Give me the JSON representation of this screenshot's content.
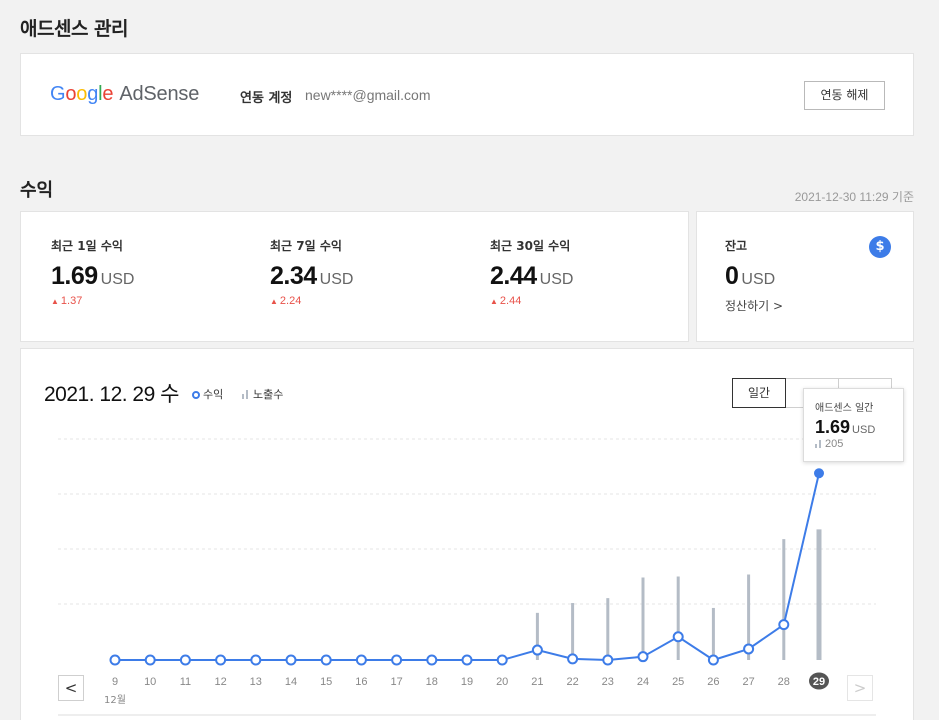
{
  "page": {
    "title": "애드센스 관리"
  },
  "adsense": {
    "logo_google": [
      "G",
      "o",
      "o",
      "g",
      "l",
      "e"
    ],
    "logo_product": "AdSense",
    "account_label": "연동 계정",
    "account_value": "new****@gmail.com",
    "unlink_label": "연동 해제"
  },
  "earnings": {
    "section_title": "수익",
    "as_of": "2021-12-30 11:29 기준",
    "stats": [
      {
        "label": "최근 1일 수익",
        "value": "1.69",
        "unit": "USD",
        "delta": "1.37"
      },
      {
        "label": "최근 7일 수익",
        "value": "2.34",
        "unit": "USD",
        "delta": "2.24"
      },
      {
        "label": "최근 30일 수익",
        "value": "2.44",
        "unit": "USD",
        "delta": "2.44"
      }
    ],
    "delta_icon": "▲"
  },
  "balance": {
    "label": "잔고",
    "value": "0",
    "unit": "USD",
    "icon": "$",
    "settle_label": "정산하기 >"
  },
  "chart_panel": {
    "date": "2021. 12. 29 수",
    "legend_revenue": "수익",
    "legend_impressions": "노출수",
    "tabs": [
      {
        "label": "일간",
        "active": true
      },
      {
        "label": "",
        "active": false
      },
      {
        "label": "",
        "active": false
      }
    ],
    "tooltip": {
      "title": "애드센스 일간",
      "value": "1.69",
      "unit": "USD",
      "impressions": "205"
    },
    "month_label": "12월",
    "prev_label": "<",
    "next_label": ">"
  },
  "chart_data": {
    "type": "line",
    "categories": [
      "9",
      "10",
      "11",
      "12",
      "13",
      "14",
      "15",
      "16",
      "17",
      "18",
      "19",
      "20",
      "21",
      "22",
      "23",
      "24",
      "25",
      "26",
      "27",
      "28",
      "29"
    ],
    "series": [
      {
        "name": "수익",
        "kind": "line",
        "color": "#3d7ce8",
        "values": [
          0,
          0,
          0,
          0,
          0,
          0,
          0,
          0,
          0,
          0,
          0,
          0,
          0.09,
          0.01,
          0,
          0.03,
          0.21,
          0,
          0.1,
          0.32,
          1.69
        ]
      },
      {
        "name": "노출수",
        "kind": "bar",
        "color": "#b4bcc6",
        "values": [
          0,
          0,
          0,
          0,
          0,
          0,
          0,
          0,
          0,
          0,
          0,
          0,
          48,
          58,
          63,
          84,
          85,
          53,
          87,
          123,
          133
        ]
      }
    ],
    "revenue_max": 2.0,
    "impressions_max": 225,
    "selected_index": 20,
    "grid": true
  }
}
